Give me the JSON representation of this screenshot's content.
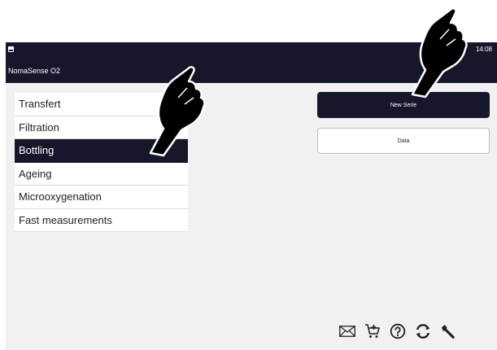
{
  "statusbar": {
    "app_title": "NomaSense O2",
    "time": "14:08"
  },
  "menu": {
    "items": [
      {
        "label": "Transfert"
      },
      {
        "label": "Filtration"
      },
      {
        "label": "Bottling"
      },
      {
        "label": "Ageing"
      },
      {
        "label": "Microoxygenation"
      },
      {
        "label": "Fast measurements"
      }
    ],
    "selected": "Bottling"
  },
  "actions": {
    "new_serie": "New Serie",
    "data": "Data"
  },
  "toolbar": {
    "icons": [
      "mail-icon",
      "cart-add-icon",
      "help-icon",
      "sync-icon",
      "wrench-icon"
    ]
  },
  "colors": {
    "dark": "#17172b",
    "background": "#f1f1f1"
  }
}
